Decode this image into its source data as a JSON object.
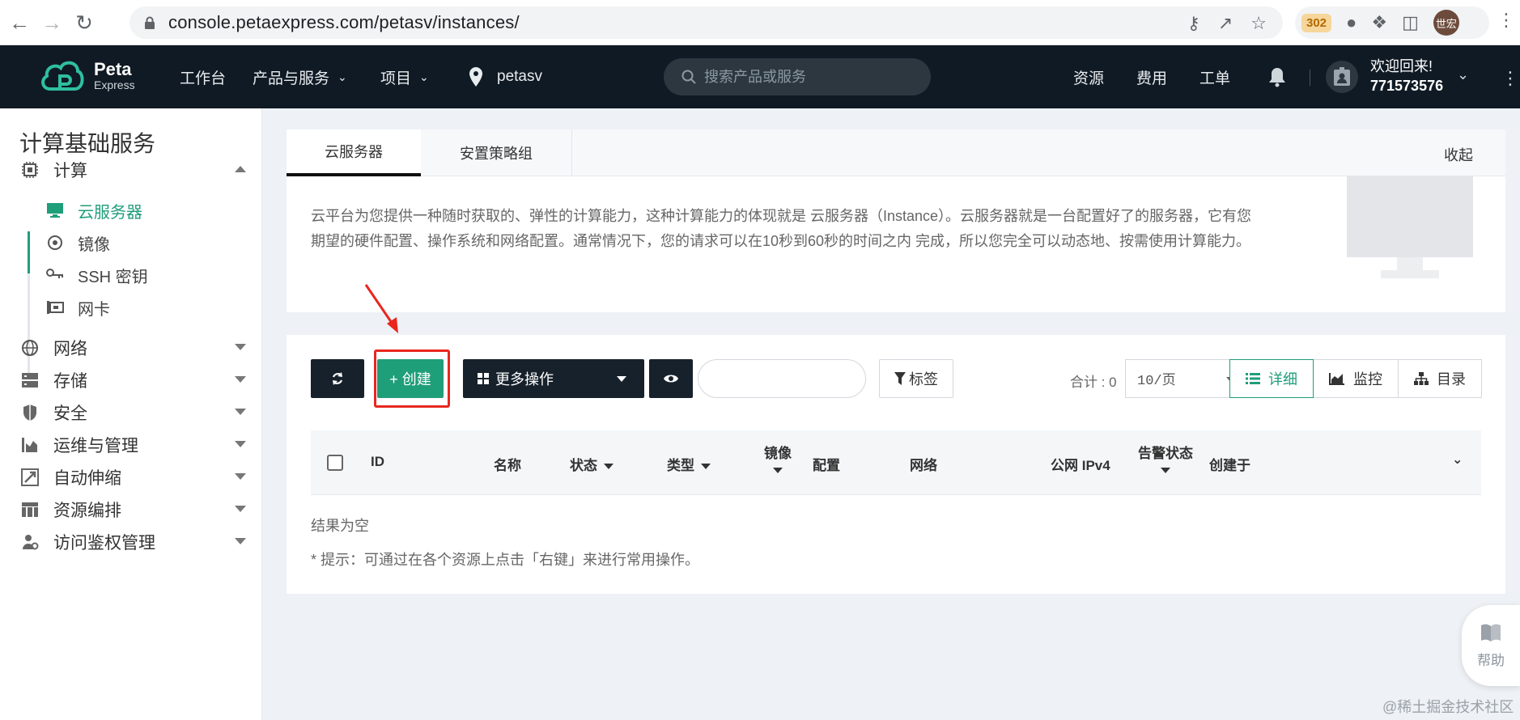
{
  "browser": {
    "url": "console.petaexpress.com/petasv/instances/",
    "ext_badge": "302",
    "profile_chip": "世宏"
  },
  "topnav": {
    "logo_main": "Peta",
    "logo_sub": "Express",
    "items": [
      "工作台",
      "产品与服务",
      "项目"
    ],
    "region": "petasv",
    "search_placeholder": "搜索产品或服务",
    "right_links": [
      "资源",
      "费用",
      "工单"
    ],
    "welcome": "欢迎回来!",
    "user_id": "771573576"
  },
  "sidebar": {
    "title": "计算基础服务",
    "compute": "计算",
    "compute_items": [
      "云服务器",
      "镜像",
      "SSH 密钥",
      "网卡"
    ],
    "sections": [
      "网络",
      "存储",
      "安全",
      "运维与管理",
      "自动伸缩",
      "资源编排",
      "访问鉴权管理"
    ]
  },
  "panel": {
    "tabs": [
      "云服务器",
      "安置策略组"
    ],
    "collapse": "收起",
    "intro_line1": "云平台为您提供一种随时获取的、弹性的计算能力，这种计算能力的体现就是 云服务器（Instance）。云服务器就是一台配置好了的服务器，它有您",
    "intro_line2": "期望的硬件配置、操作系统和网络配置。通常情况下，您的请求可以在10秒到60秒的时间之内 完成，所以您完全可以动态地、按需使用计算能力。"
  },
  "toolbar": {
    "create": "+ 创建",
    "more_actions": "更多操作",
    "tags": "标签",
    "count": "合计 : 0",
    "per_page": "10/页",
    "views": [
      "详细",
      "监控",
      "目录"
    ]
  },
  "table": {
    "columns": [
      "ID",
      "名称",
      "状态",
      "类型",
      "镜像",
      "配置",
      "网络",
      "公网 IPv4",
      "告警状态",
      "创建于"
    ],
    "empty": "结果为空",
    "tip": "* 提示：可通过在各个资源上点击「右键」来进行常用操作。"
  },
  "help": "帮助",
  "watermark": "@稀土掘金技术社区",
  "colors": {
    "accent": "#1f9e7a",
    "nav_bg": "#0f1a24",
    "highlight": "#e8271f"
  }
}
